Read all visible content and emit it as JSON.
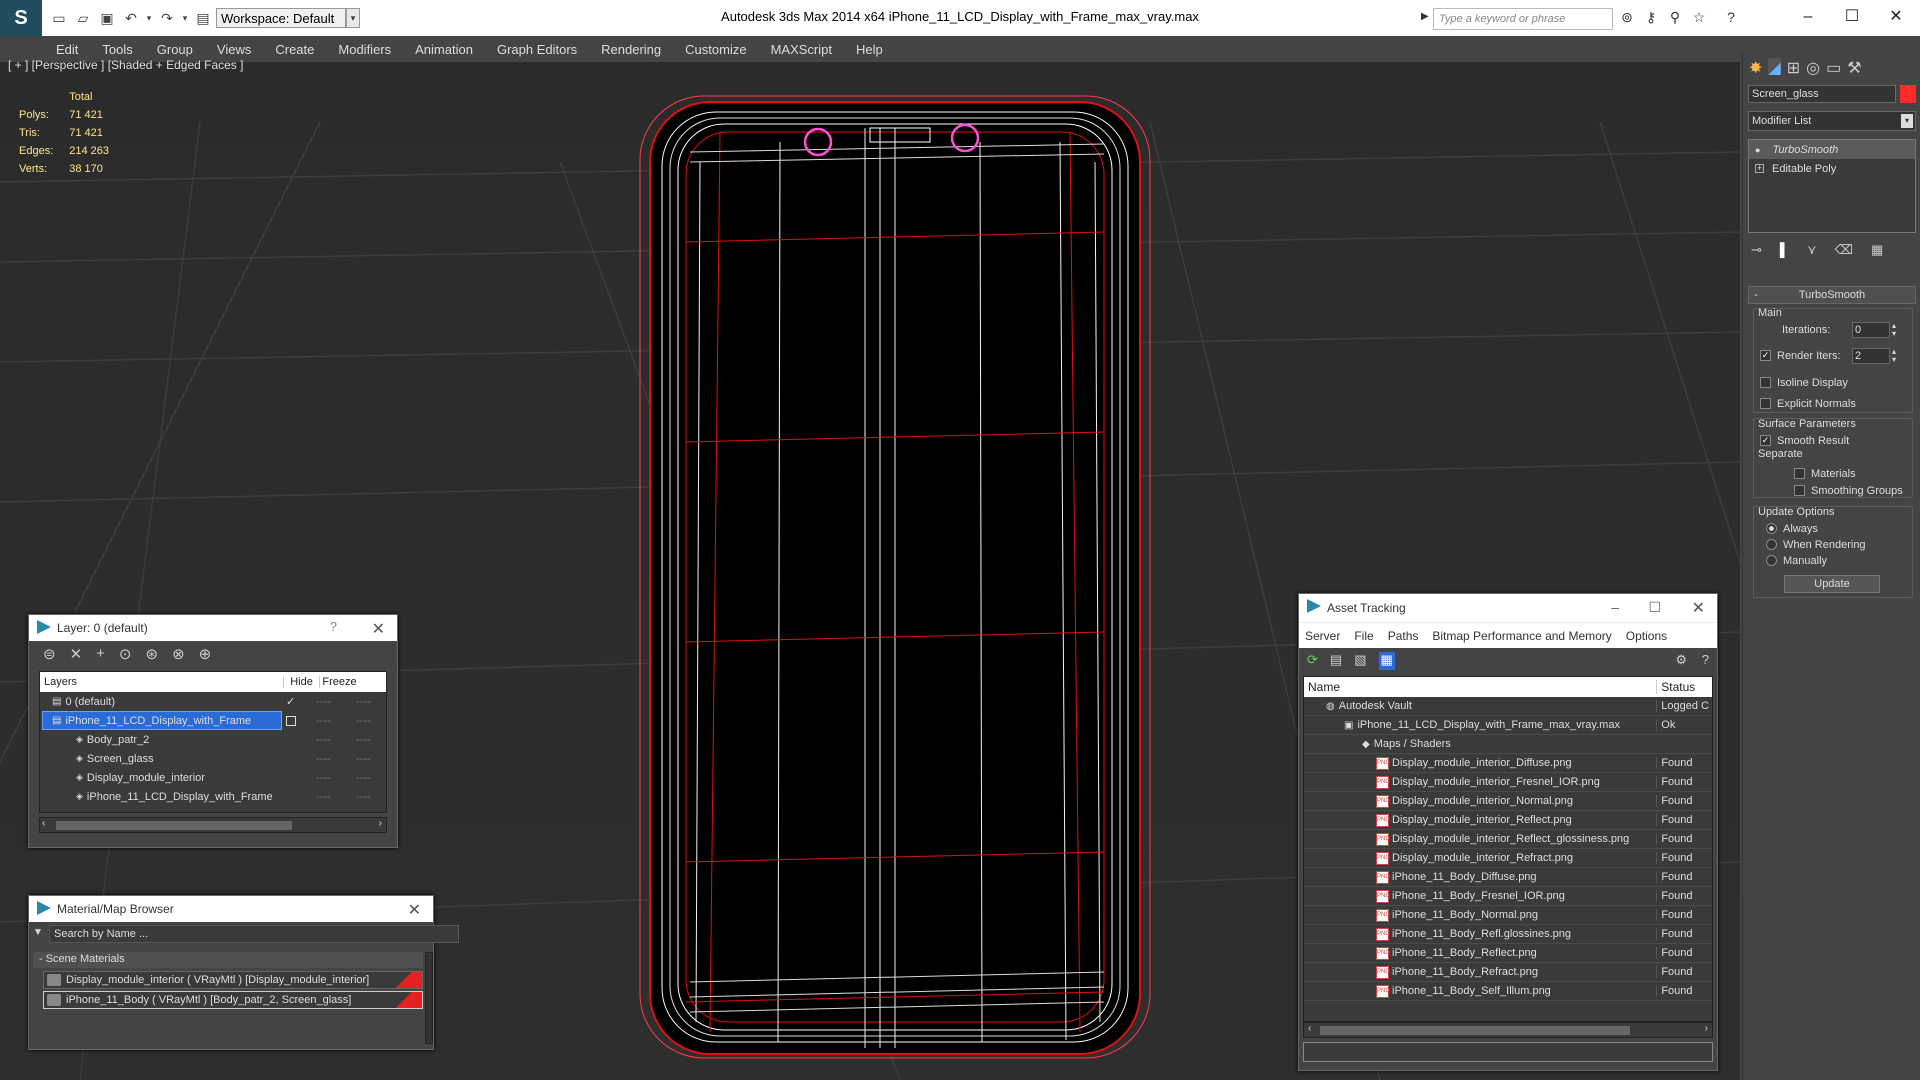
{
  "app": {
    "title": "Autodesk 3ds Max  2014 x64      iPhone_11_LCD_Display_with_Frame_max_vray.max",
    "workspace": "Workspace: Default",
    "search_placeholder": "Type a keyword or phrase"
  },
  "menu": [
    "Edit",
    "Tools",
    "Group",
    "Views",
    "Create",
    "Modifiers",
    "Animation",
    "Graph Editors",
    "Rendering",
    "Customize",
    "MAXScript",
    "Help"
  ],
  "viewport": {
    "label": "[ + ] [Perspective ] [Shaded + Edged Faces ]",
    "stats": {
      "header": "Total",
      "rows": [
        {
          "label": "Polys:",
          "value": "71 421"
        },
        {
          "label": "Tris:",
          "value": "71 421"
        },
        {
          "label": "Edges:",
          "value": "214 263"
        },
        {
          "label": "Verts:",
          "value": "38 170"
        }
      ]
    }
  },
  "command_panel": {
    "object_name": "Screen_glass",
    "modifier_list": "Modifier List",
    "stack": [
      "TurboSmooth",
      "Editable Poly"
    ],
    "rollout_title": "TurboSmooth",
    "main_label": "Main",
    "iterations_label": "Iterations:",
    "iterations_value": "0",
    "render_iters_label": "Render Iters:",
    "render_iters_value": "2",
    "isoline": "Isoline Display",
    "explicit_normals": "Explicit Normals",
    "surface_params": "Surface Parameters",
    "smooth_result": "Smooth Result",
    "separate": "Separate",
    "materials": "Materials",
    "smoothing_groups": "Smoothing Groups",
    "update_options": "Update Options",
    "always": "Always",
    "when_rendering": "When Rendering",
    "manually": "Manually",
    "update_button": "Update"
  },
  "layer_panel": {
    "title": "Layer: 0 (default)",
    "help": "?",
    "col_layers": "Layers",
    "col_hide": "Hide",
    "col_freeze": "Freeze",
    "rows": [
      {
        "name": "0 (default)",
        "indent": 0
      },
      {
        "name": "iPhone_11_LCD_Display_with_Frame",
        "indent": 0
      },
      {
        "name": "Body_patr_2",
        "indent": 1
      },
      {
        "name": "Screen_glass",
        "indent": 1
      },
      {
        "name": "Display_module_interior",
        "indent": 1
      },
      {
        "name": "iPhone_11_LCD_Display_with_Frame",
        "indent": 1
      }
    ]
  },
  "material_browser": {
    "title": "Material/Map Browser",
    "search_placeholder": "Search by Name ...",
    "group": "- Scene Materials",
    "items": [
      "Display_module_interior ( VRayMtl ) [Display_module_interior]",
      "iPhone_11_Body  ( VRayMtl ) [Body_patr_2, Screen_glass]"
    ]
  },
  "asset_tracking": {
    "title": "Asset Tracking",
    "menu": [
      "Server",
      "File",
      "Paths",
      "Bitmap Performance and Memory",
      "Options"
    ],
    "col_name": "Name",
    "col_status": "Status",
    "vault": {
      "name": "Autodesk Vault",
      "status": "Logged C"
    },
    "file": {
      "name": "iPhone_11_LCD_Display_with_Frame_max_vray.max",
      "status": "Ok"
    },
    "maps_label": "Maps / Shaders",
    "maps": [
      {
        "name": "Display_module_interior_Diffuse.png",
        "status": "Found"
      },
      {
        "name": "Display_module_interior_Fresnel_IOR.png",
        "status": "Found"
      },
      {
        "name": "Display_module_interior_Normal.png",
        "status": "Found"
      },
      {
        "name": "Display_module_interior_Reflect.png",
        "status": "Found"
      },
      {
        "name": "Display_module_interior_Reflect_glossiness.png",
        "status": "Found"
      },
      {
        "name": "Display_module_interior_Refract.png",
        "status": "Found"
      },
      {
        "name": "iPhone_11_Body_Diffuse.png",
        "status": "Found"
      },
      {
        "name": "iPhone_11_Body_Fresnel_IOR.png",
        "status": "Found"
      },
      {
        "name": "iPhone_11_Body_Normal.png",
        "status": "Found"
      },
      {
        "name": "iPhone_11_Body_Refl.glossines.png",
        "status": "Found"
      },
      {
        "name": "iPhone_11_Body_Reflect.png",
        "status": "Found"
      },
      {
        "name": "iPhone_11_Body_Refract.png",
        "status": "Found"
      },
      {
        "name": "iPhone_11_Body_Self_Illum.png",
        "status": "Found"
      }
    ]
  }
}
